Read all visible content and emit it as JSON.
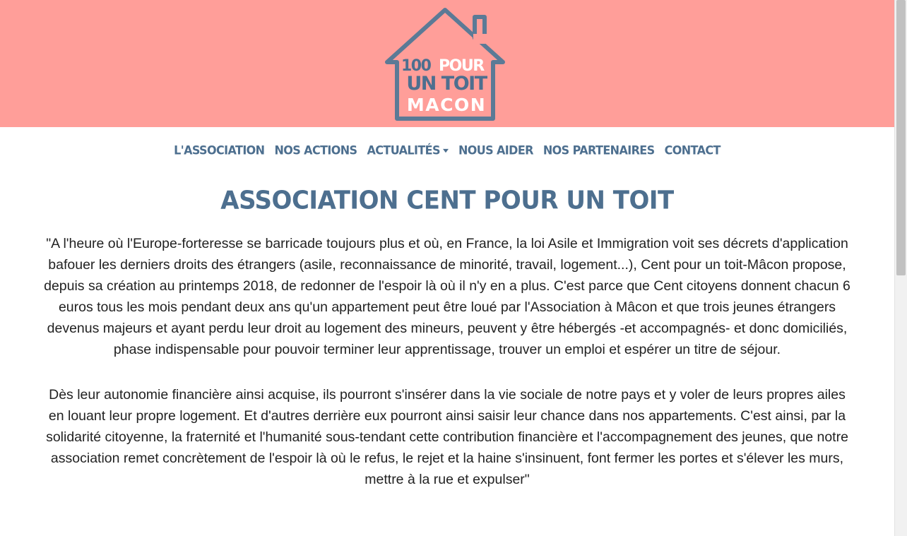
{
  "brand": {
    "logo_line1_a": "100",
    "logo_line1_b": "POUR",
    "logo_line2": "UN TOIT",
    "logo_line3": "MACON",
    "banner_color": "#ff9e99",
    "logo_color": "#4d6f8f"
  },
  "nav": {
    "items": [
      {
        "label": "L'ASSOCIATION"
      },
      {
        "label": "NOS ACTIONS"
      },
      {
        "label": "ACTUALITÉS",
        "dropdown": true
      },
      {
        "label": "NOUS AIDER"
      },
      {
        "label": "NOS PARTENAIRES"
      },
      {
        "label": "CONTACT"
      }
    ]
  },
  "main": {
    "title": "ASSOCIATION CENT POUR UN TOIT",
    "paragraphs": [
      "\"A l'heure où l'Europe-forteresse se barricade toujours plus et où, en France, la loi Asile et Immigration voit ses décrets d'application bafouer les derniers droits des étrangers (asile, reconnaissance de minorité, travail, logement...), Cent pour un toit-Mâcon propose, depuis sa création au printemps 2018, de redonner de l'espoir là où il n'y en a plus. C'est parce que Cent citoyens donnent chacun 6 euros tous les mois pendant deux ans qu'un appartement peut être loué par l'Association à Mâcon et que trois jeunes étrangers devenus majeurs et ayant perdu leur droit au logement des mineurs, peuvent y être hébergés -et accompagnés- et donc domiciliés, phase indispensable pour pouvoir terminer leur apprentissage, trouver un emploi et espérer un titre de séjour.",
      "Dès leur autonomie financière ainsi acquise, ils pourront s'insérer dans la vie sociale de notre pays et y voler de leurs propres ailes en louant leur propre logement. Et d'autres derrière eux pourront ainsi saisir leur chance dans nos appartements. C'est ainsi, par la solidarité citoyenne, la fraternité et l'humanité sous-tendant cette contribution financière et l'accompagnement des jeunes, que notre association remet concrètement de l'espoir là où le refus, le rejet et la haine s'insinuent, font fermer les portes et s'élever les murs, mettre à la rue et expulser\""
    ]
  }
}
